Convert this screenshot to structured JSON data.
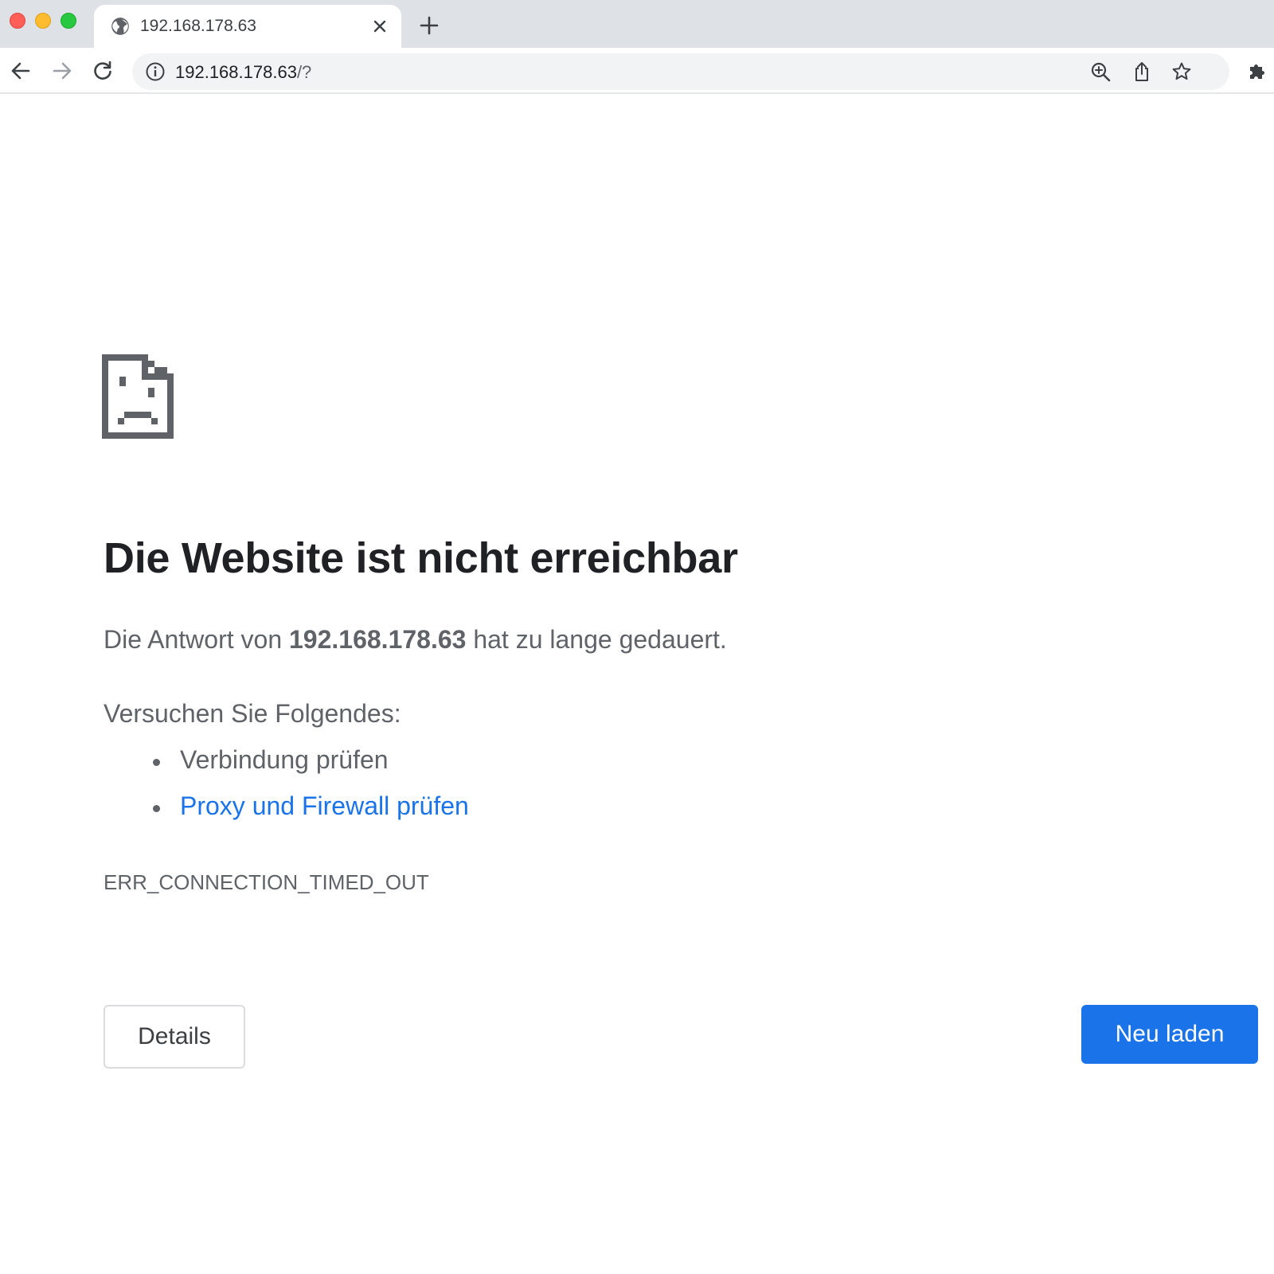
{
  "colors": {
    "tabstrip_bg": "#dee1e6",
    "link": "#1a73e8",
    "primary_button": "#1a73e8",
    "text_secondary": "#5f6368"
  },
  "window": {
    "controls": [
      "close",
      "minimize",
      "maximize"
    ]
  },
  "tab": {
    "favicon": "globe-icon",
    "title": "192.168.178.63",
    "close_icon": "close-icon"
  },
  "new_tab_icon": "plus-icon",
  "toolbar": {
    "back_icon": "arrow-left-icon",
    "forward_icon": "arrow-right-icon",
    "reload_icon": "reload-icon",
    "info_icon": "info-icon",
    "url_host": "192.168.178.63",
    "url_rest": "/?",
    "zoom_icon": "zoom-in-icon",
    "share_icon": "share-icon",
    "bookmark_icon": "star-icon",
    "extensions_icon": "puzzle-icon"
  },
  "error": {
    "icon": "sad-page-icon",
    "heading": "Die Website ist nicht erreichbar",
    "summary_prefix": "Die Antwort von",
    "summary_host": "192.168.178.63",
    "summary_suffix": "hat zu lange gedauert.",
    "suggestions_title": "Versuchen Sie Folgendes:",
    "suggestions": [
      {
        "label": "Verbindung prüfen",
        "link": false
      },
      {
        "label": "Proxy und Firewall prüfen",
        "link": true
      }
    ],
    "code": "ERR_CONNECTION_TIMED_OUT",
    "details_button": "Details",
    "reload_button": "Neu laden"
  }
}
